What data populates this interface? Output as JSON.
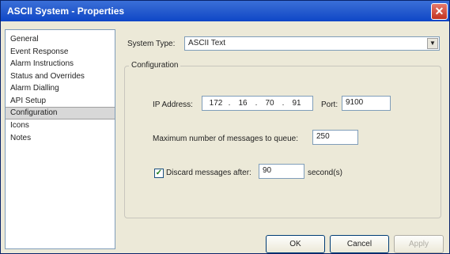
{
  "window": {
    "title": "ASCII System - Properties"
  },
  "sidebar": {
    "items": [
      {
        "label": "General"
      },
      {
        "label": "Event Response"
      },
      {
        "label": "Alarm Instructions"
      },
      {
        "label": "Status and Overrides"
      },
      {
        "label": "Alarm Dialling"
      },
      {
        "label": "API Setup"
      },
      {
        "label": "Configuration"
      },
      {
        "label": "Icons"
      },
      {
        "label": "Notes"
      }
    ],
    "selected": "Configuration"
  },
  "system_type": {
    "label": "System Type:",
    "value": "ASCII Text"
  },
  "configuration": {
    "group_label": "Configuration",
    "ip_label": "IP Address:",
    "ip": [
      "172",
      "16",
      "70",
      "91"
    ],
    "port_label": "Port:",
    "port": "9100",
    "max_label": "Maximum number of messages to queue:",
    "max_value": "250",
    "discard_label": "Discard messages after:",
    "discard_checked": true,
    "discard_value": "90",
    "seconds_label": "second(s)"
  },
  "buttons": {
    "ok": "OK",
    "cancel": "Cancel",
    "apply": "Apply"
  }
}
